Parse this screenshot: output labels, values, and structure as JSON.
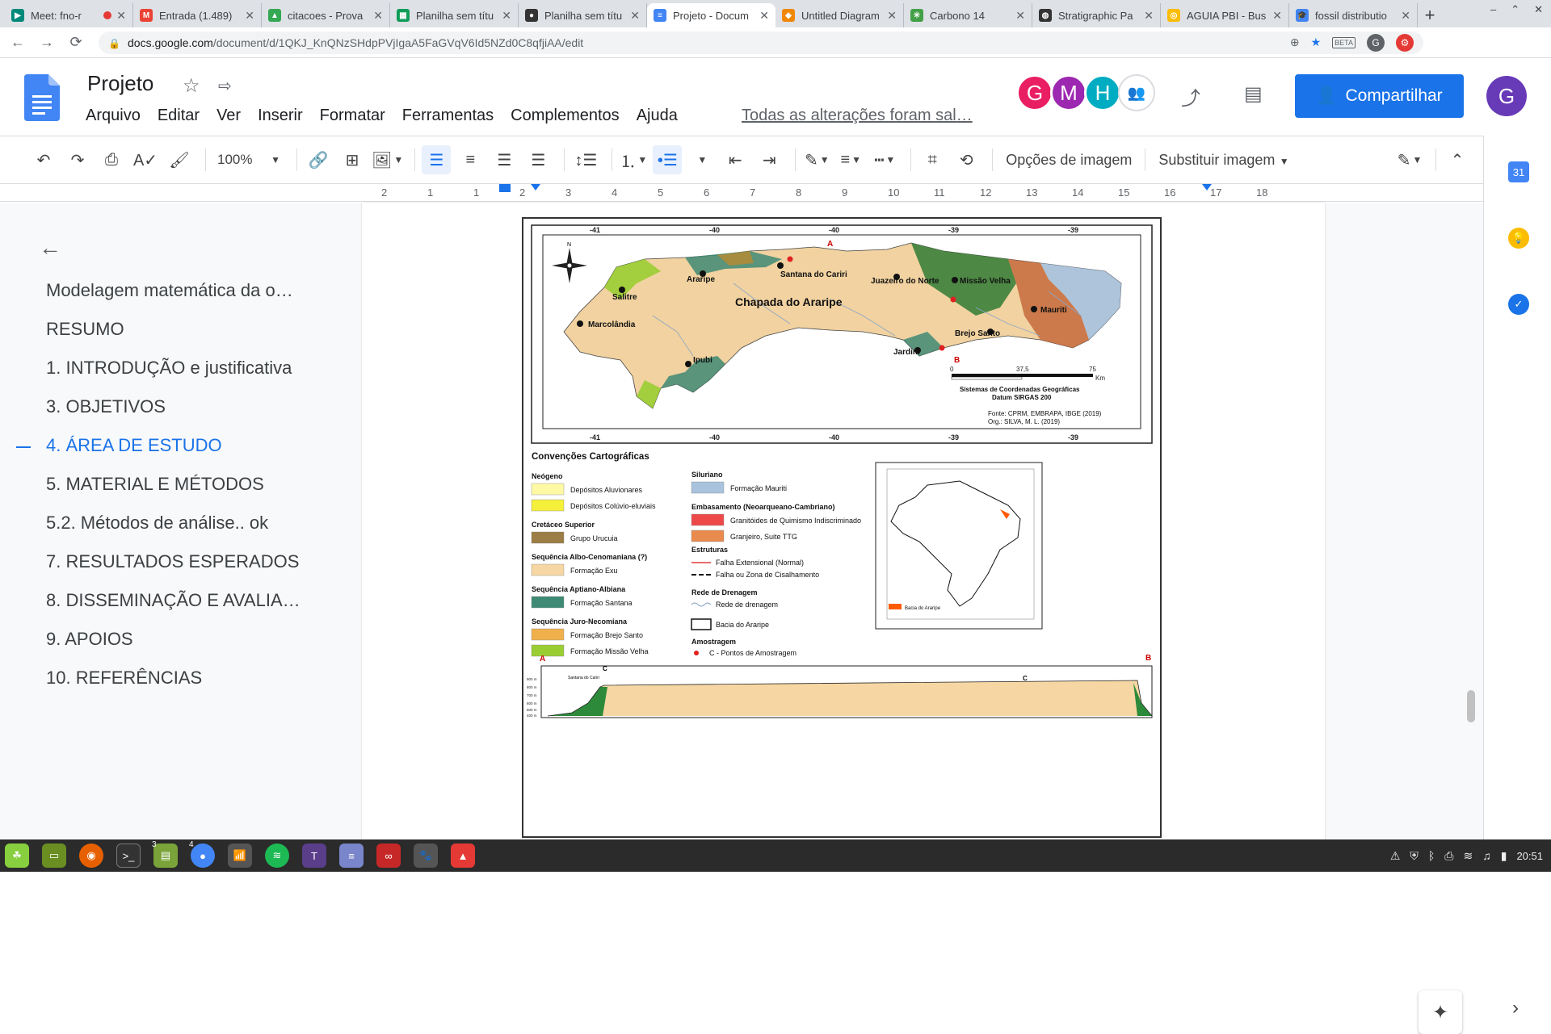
{
  "browser": {
    "tabs": [
      {
        "title": "Meet: fno-r",
        "icon": "meet-icon",
        "recording": true
      },
      {
        "title": "Entrada (1.489)",
        "icon": "gmail-icon"
      },
      {
        "title": "citacoes - Prova",
        "icon": "drive-icon"
      },
      {
        "title": "Planilha sem títu",
        "icon": "sheets-icon"
      },
      {
        "title": "Planilha sem títu",
        "icon": "github-icon"
      },
      {
        "title": "Projeto - Docum",
        "icon": "docs-icon",
        "active": true
      },
      {
        "title": "Untitled Diagram",
        "icon": "drawio-icon"
      },
      {
        "title": "Carbono 14",
        "icon": "carbon-icon"
      },
      {
        "title": "Stratigraphic Pa",
        "icon": "globe-icon"
      },
      {
        "title": "AGUIA PBI - Bus",
        "icon": "chrome-icon"
      },
      {
        "title": "fossil distributio",
        "icon": "scholar-icon"
      }
    ],
    "new_tab": "+",
    "url_host": "docs.google.com",
    "url_path": "/document/d/1QKJ_KnQNzSHdpPVjIgaA5FaGVqV6Id5NZd0C8qfjiAA/edit",
    "extension_badge": "BETA",
    "profile_letter": "G"
  },
  "docs": {
    "title": "Projeto",
    "menu": [
      "Arquivo",
      "Editar",
      "Ver",
      "Inserir",
      "Formatar",
      "Ferramentas",
      "Complementos",
      "Ajuda"
    ],
    "save_status": "Todas as alterações foram sal…",
    "collaborators": [
      {
        "letter": "G",
        "color": "#e91e63"
      },
      {
        "letter": "M",
        "color": "#9c27b0"
      },
      {
        "letter": "H",
        "color": "#00acc1"
      }
    ],
    "share_label": "Compartilhar",
    "account_letter": "G"
  },
  "toolbar": {
    "zoom": "100%",
    "image_options": "Opções de imagem",
    "replace_image": "Substituir imagem"
  },
  "ruler": {
    "numbers": [
      "2",
      "1",
      "1",
      "2",
      "3",
      "4",
      "5",
      "6",
      "7",
      "8",
      "9",
      "10",
      "11",
      "12",
      "13",
      "14",
      "15",
      "16",
      "17",
      "18"
    ]
  },
  "outline": {
    "items": [
      {
        "label": "Modelagem matemática da o…",
        "active": false
      },
      {
        "label": "RESUMO",
        "active": false
      },
      {
        "label": "1. INTRODUÇÃO e justificativa",
        "active": false
      },
      {
        "label": "3. OBJETIVOS",
        "active": false
      },
      {
        "label": "4. ÁREA DE ESTUDO",
        "active": true
      },
      {
        "label": "5. MATERIAL E MÉTODOS",
        "active": false
      },
      {
        "label": "5.2. Métodos de análise.. ok",
        "active": false
      },
      {
        "label": "7. RESULTADOS ESPERADOS",
        "active": false
      },
      {
        "label": "8. DISSEMINAÇÃO E AVALIA…",
        "active": false
      },
      {
        "label": "9. APOIOS",
        "active": false
      },
      {
        "label": "10. REFERÊNCIAS",
        "active": false
      }
    ]
  },
  "figure": {
    "map_title": "Chapada do Araripe",
    "top_ticks": [
      "-41",
      "-40",
      "-40",
      "-39",
      "-39"
    ],
    "bottom_ticks": [
      "-41",
      "-40",
      "-40",
      "-39",
      "-39"
    ],
    "places": [
      "Salitre",
      "Araripe",
      "Santana do Cariri",
      "Juazeiro do Norte",
      "Missão Velha",
      "Marcolândia",
      "Mauriti",
      "Brejo Santo",
      "Jardim",
      "Ipubi"
    ],
    "point_a": "A",
    "point_b": "B",
    "scale": [
      "0",
      "37,5",
      "75",
      "Km"
    ],
    "crs_line1": "Sistemas de Coordenadas Geográficas",
    "crs_line2": "Datum SIRGAS 200",
    "source_line1": "Fonte: CPRM, EMBRAPA, IBGE (2019)",
    "source_line2": "Org.: SILVA, M. L. (2019)",
    "legend_title": "Convenções Cartográficas",
    "legend_left": [
      {
        "group": "Neógeno",
        "items": [
          {
            "label": "Depósitos Aluvionares",
            "color": "#fff9a6"
          },
          {
            "label": "Depósitos Colúvio-eluviais",
            "color": "#f5f03a"
          }
        ]
      },
      {
        "group": "Cretáceo Superior",
        "items": [
          {
            "label": "Grupo Urucuia",
            "color": "#9b7d45"
          }
        ]
      },
      {
        "group": "Sequência Albo-Cenomaniana (?)",
        "items": [
          {
            "label": "Formação Exu",
            "color": "#f6d7a3"
          }
        ]
      },
      {
        "group": "Sequência Aptiano-Albiana",
        "items": [
          {
            "label": "Formação Santana",
            "color": "#3e8a74"
          }
        ]
      },
      {
        "group": "Sequência Juro-Necomiana",
        "items": [
          {
            "label": "Formação Brejo Santo",
            "color": "#f0b04b"
          },
          {
            "label": "Formação Missão Velha",
            "color": "#9acd32"
          }
        ]
      }
    ],
    "legend_right": [
      {
        "group": "Siluriano",
        "items": [
          {
            "label": "Formação Mauriti",
            "color": "#a9c3de"
          }
        ]
      },
      {
        "group": "Embasamento (Neoarqueano-Cambriano)",
        "items": [
          {
            "label": "Granitóides de Quimismo Indiscriminado",
            "color": "#ee4949"
          },
          {
            "label": "Granjeiro, Suite TTG",
            "color": "#e98b4f"
          }
        ]
      }
    ],
    "structures_title": "Estruturas",
    "fault_normal": "Falha Extensional (Normal)",
    "fault_shear": "Falha ou Zona de Cisalhamento",
    "drainage_title": "Rede de Drenagem",
    "drainage_item": "Rede de drenagem",
    "basin_item": "Bacia do Araripe",
    "sampling_title": "Amostragem",
    "sampling_item": "C - Pontos de Amostragem",
    "inset_label": "Bacia do Araripe",
    "profile_a": "A",
    "profile_b": "B",
    "profile_c1": "C",
    "profile_c2": "C",
    "profile_place": "Santana do Cariri",
    "profile_y": [
      "900 m",
      "800 m",
      "700 m",
      "600 m",
      "500 m",
      "400 m"
    ]
  },
  "taskbar": {
    "badge1": "3",
    "badge2": "4",
    "clock": "20:51"
  }
}
